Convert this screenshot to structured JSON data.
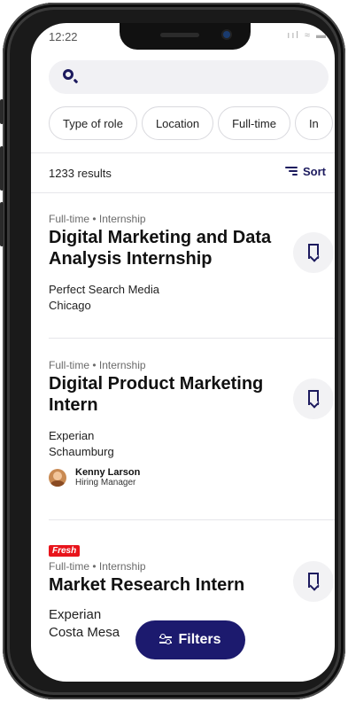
{
  "status_bar": {
    "time": "12:22",
    "indicators": "ııl ≈ ▬"
  },
  "search": {
    "placeholder": ""
  },
  "chips": [
    "Type of role",
    "Location",
    "Full-time",
    "In"
  ],
  "results": {
    "count_label": "1233 results",
    "sort_label": "Sort"
  },
  "jobs": [
    {
      "meta": "Full-time • Internship",
      "title": "Digital Marketing and Data Analysis Internship",
      "company": "Perfect Search Media",
      "location": "Chicago"
    },
    {
      "meta": "Full-time • Internship",
      "title": "Digital Product Marketing Intern",
      "company": "Experian",
      "location": "Schaumburg",
      "manager": {
        "name": "Kenny Larson",
        "role": "Hiring Manager"
      }
    },
    {
      "badge": "Fresh",
      "meta": "Full-time • Internship",
      "title": "Market Research Intern",
      "company": "Experian",
      "location": "Costa Mesa"
    }
  ],
  "filters_button": {
    "label": "Filters"
  },
  "colors": {
    "brand": "#1c1a6e",
    "badge": "#e8141b",
    "chip_border": "#d9d9de"
  }
}
